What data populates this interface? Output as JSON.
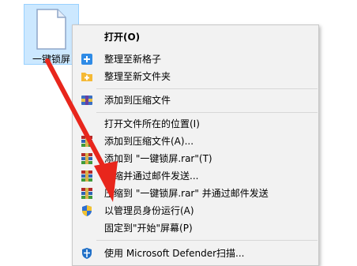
{
  "desktop": {
    "file_label": "一键锁屏"
  },
  "menu": {
    "items": [
      {
        "label": "打开(O)",
        "icon": "none",
        "bold": true
      },
      {
        "label": "整理至新格子",
        "icon": "fences-plus-icon"
      },
      {
        "label": "整理至新文件夹",
        "icon": "folder-plus-icon"
      },
      {
        "label": "添加到压缩文件",
        "icon": "winrar-icon"
      },
      {
        "label": "打开文件所在的位置(I)",
        "icon": "none"
      },
      {
        "label": "添加到压缩文件(A)...",
        "icon": "winrar-archive-icon"
      },
      {
        "label": "添加到 \"一键锁屏.rar\"(T)",
        "icon": "winrar-archive-icon"
      },
      {
        "label": "压缩并通过邮件发送...",
        "icon": "winrar-archive-icon"
      },
      {
        "label": "压缩到 \"一键锁屏.rar\" 并通过邮件发送",
        "icon": "winrar-archive-icon"
      },
      {
        "label": "以管理员身份运行(A)",
        "icon": "uac-shield-icon"
      },
      {
        "label": "固定到\"开始\"屏幕(P)",
        "icon": "none"
      },
      {
        "label": "使用 Microsoft Defender扫描...",
        "icon": "defender-icon"
      }
    ]
  },
  "colors": {
    "arrow": "#e8261c",
    "selection": "#cce8ff",
    "menu_bg": "#f2f2f2"
  }
}
